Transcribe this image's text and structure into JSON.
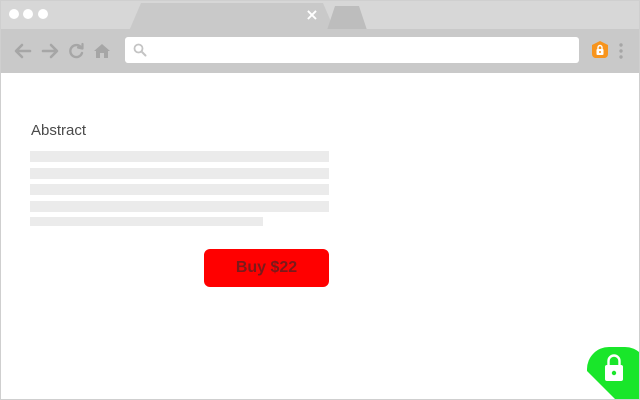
{
  "browser": {
    "tab_close_glyph": "×",
    "address_value": "",
    "address_placeholder": "",
    "colors": {
      "chrome": "#d7d7d7",
      "toolbar": "#c9c9c9",
      "extension": "#f7941d",
      "badge": "#19e62a"
    }
  },
  "icons": {
    "back": "back-arrow-icon",
    "forward": "forward-arrow-icon",
    "reload": "reload-icon",
    "home": "home-icon",
    "search": "search-icon",
    "extension": "lock-extension-icon",
    "menu": "kebab-menu-icon",
    "badge": "padlock-icon"
  },
  "content": {
    "heading": "Abstract",
    "buy_label": "Buy $22",
    "button_color": "#ff0000",
    "placeholder_lines": 5
  }
}
